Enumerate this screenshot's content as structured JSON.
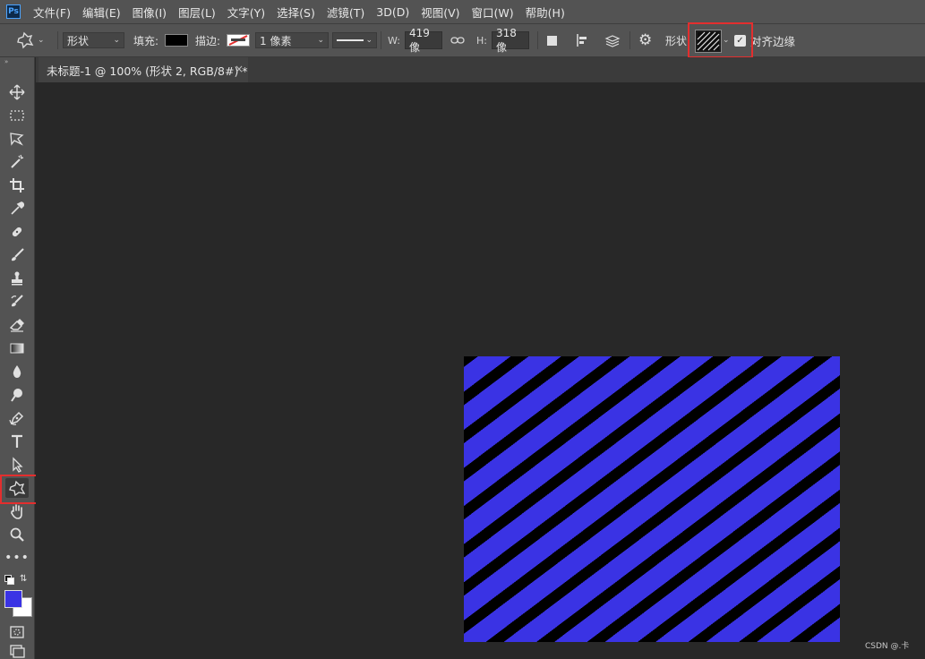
{
  "app": {
    "logo_text": "Ps"
  },
  "menu": {
    "items": [
      "文件(F)",
      "编辑(E)",
      "图像(I)",
      "图层(L)",
      "文字(Y)",
      "选择(S)",
      "滤镜(T)",
      "3D(D)",
      "视图(V)",
      "窗口(W)",
      "帮助(H)"
    ]
  },
  "options": {
    "mode_value": "形状",
    "fill_label": "填充:",
    "fill_color": "#000000",
    "stroke_label": "描边:",
    "stroke_width": "1 像素",
    "w_label": "W:",
    "w_value": "419 像",
    "h_label": "H:",
    "h_value": "318 像",
    "shape_label": "形状",
    "align_edges_label": "对齐边缘",
    "align_edges_checked": true
  },
  "document": {
    "tab_title": "未标题-1 @ 100% (形状 2, RGB/8#) *",
    "close_glyph": "×"
  },
  "colors": {
    "foreground": "#3a33e4",
    "background": "#ffffff",
    "stripe_dark": "#000000",
    "highlight": "#e32e2e"
  },
  "watermark": "CSDN @.卡"
}
